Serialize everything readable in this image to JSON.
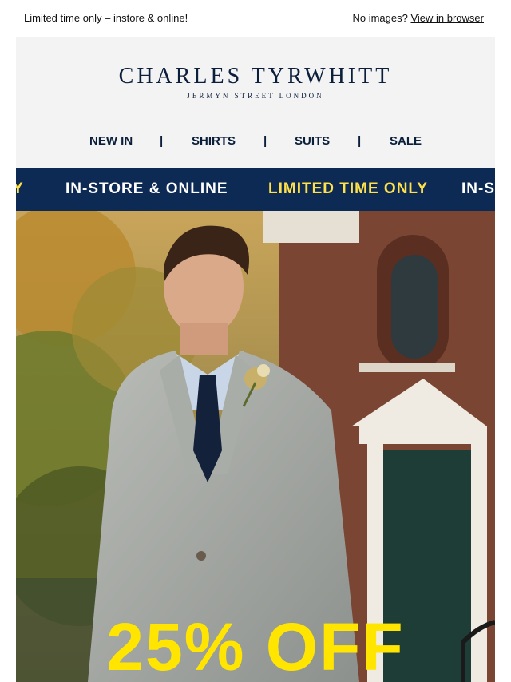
{
  "preheader": {
    "left_text": "Limited time only – instore & online!",
    "no_images_text": "No images?",
    "view_in_browser": "View in browser"
  },
  "header": {
    "brand": "CHARLES TYRWHITT",
    "tagline": "JERMYN STREET LONDON"
  },
  "nav": {
    "items": [
      "NEW IN",
      "SHIRTS",
      "SUITS",
      "SALE"
    ],
    "separator": "|"
  },
  "ticker": {
    "items": [
      "Y",
      "IN-STORE & ONLINE",
      "LIMITED TIME ONLY",
      "IN-S"
    ],
    "colors": {
      "background": "#0d2a55",
      "white_text": "#ffffff",
      "yellow_text": "#ffe14a"
    }
  },
  "hero": {
    "offer_text": "25% OFF",
    "offer_color": "#ffe500"
  }
}
